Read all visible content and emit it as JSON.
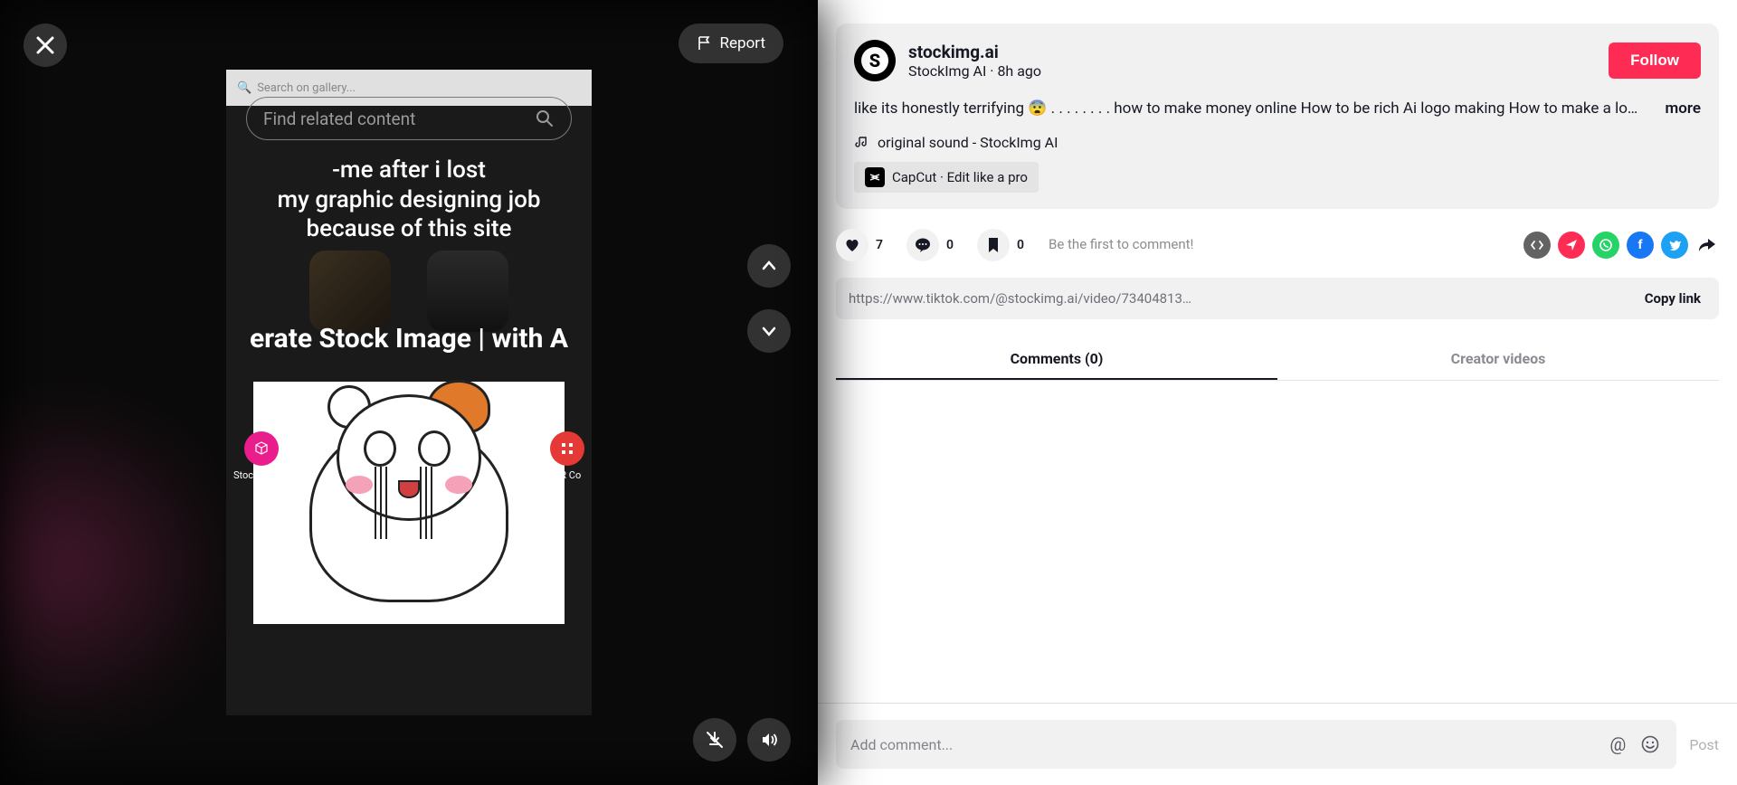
{
  "video": {
    "searchPlaceholder": "Search on gallery...",
    "findRelated": "Find related content",
    "captionLines": "-me after i lost\nmy graphic designing job\nbecause of this site",
    "genTitle": "erate Stock Image | with A",
    "sideLeft": "Stock Image",
    "sideRight": "QR Co"
  },
  "controls": {
    "report": "Report"
  },
  "creator": {
    "username": "stockimg.ai",
    "displayName": "StockImg AI",
    "timeAgo": "8h ago",
    "follow": "Follow",
    "caption": "like its honestly terrifying 😨 . . . . . . . . how to make money online How to be rich Ai logo making How to make a lo…",
    "more": "more",
    "sound": "original sound - StockImg AI",
    "capcut": "CapCut · Edit like a pro"
  },
  "stats": {
    "likes": "7",
    "comments": "0",
    "bookmarks": "0",
    "prompt": "Be the first to comment!"
  },
  "share": {
    "url": "https://www.tiktok.com/@stockimg.ai/video/73404813…",
    "copy": "Copy link"
  },
  "tabs": {
    "comments": "Comments (0)",
    "creatorVideos": "Creator videos"
  },
  "commentBar": {
    "placeholder": "Add comment...",
    "post": "Post"
  }
}
